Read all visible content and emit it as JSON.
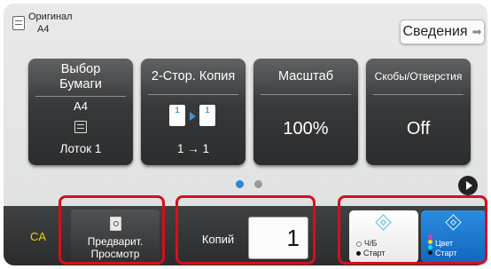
{
  "original": {
    "label": "Оригинал",
    "size": "A4"
  },
  "details_button": {
    "label": "Сведения"
  },
  "tiles": [
    {
      "title": "Выбор Бумаги",
      "value": "A4",
      "sub": "Лоток 1"
    },
    {
      "title": "2-Стор. Копия",
      "value": "1 → 1",
      "page_a": "1",
      "page_b": "1"
    },
    {
      "title": "Масштаб",
      "value": "100%"
    },
    {
      "title": "Скобы/Отверстия",
      "value": "Off"
    }
  ],
  "pager": {
    "pages": 2,
    "current": 1
  },
  "bottom": {
    "ca_label": "CA",
    "preview_label_1": "Предварит.",
    "preview_label_2": "Просмотр",
    "copies_label": "Копий",
    "copies_value": "1",
    "bw_start_1": "Ч/Б",
    "bw_start_2": "Старт",
    "color_start_1": "Цвет",
    "color_start_2": "Старт"
  },
  "colors": {
    "accent": "#2e86d6",
    "highlight_frame": "#d3111c",
    "ca": "#f2d000",
    "color_start": "#1c76d2"
  },
  "icons": [
    "document-icon",
    "arrow-right-icon",
    "tray-icon",
    "duplex-icon",
    "preview-icon",
    "start-diamond-icon",
    "next-page-icon"
  ]
}
